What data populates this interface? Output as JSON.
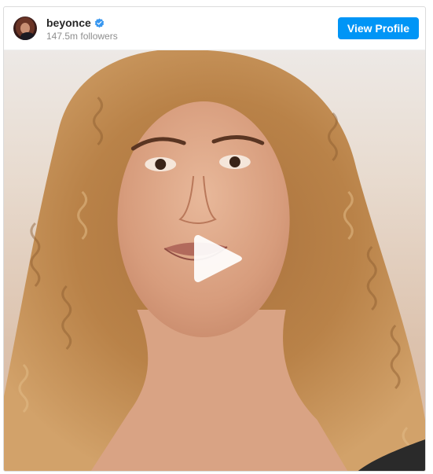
{
  "post": {
    "username": "beyonce",
    "verified": true,
    "followers": "147.5m followers",
    "view_profile_label": "View Profile"
  },
  "icons": {
    "verified": "verified-badge-icon",
    "play": "play-icon"
  },
  "colors": {
    "accent": "#0095f6",
    "username": "#262626",
    "secondary_text": "#8e8e8e",
    "border": "#dbdbdb"
  }
}
